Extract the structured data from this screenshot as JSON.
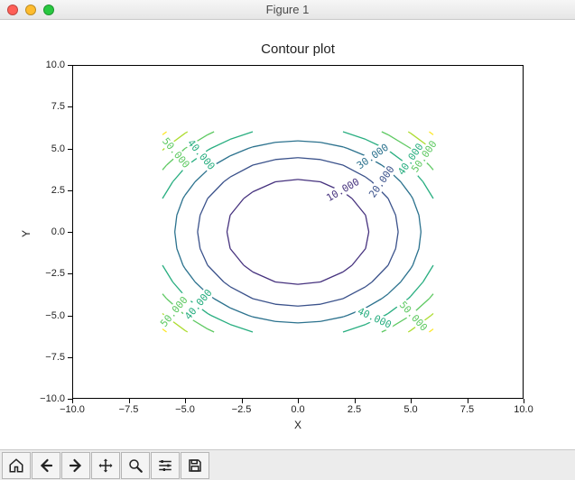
{
  "window": {
    "title": "Figure 1"
  },
  "chart_data": {
    "type": "contour",
    "title": "Contour plot",
    "xlabel": "X",
    "ylabel": "Y",
    "xlim": [
      -10.0,
      10.0
    ],
    "ylim": [
      -10.0,
      10.0
    ],
    "xticks": [
      -10.0,
      -7.5,
      -5.0,
      -2.5,
      0.0,
      2.5,
      5.0,
      7.5,
      10.0
    ],
    "yticks": [
      -10.0,
      -7.5,
      -5.0,
      -2.5,
      0.0,
      2.5,
      5.0,
      7.5,
      10.0
    ],
    "xtick_labels": [
      "−10.0",
      "−7.5",
      "−5.0",
      "−2.5",
      "0.0",
      "2.5",
      "5.0",
      "7.5",
      "10.0"
    ],
    "ytick_labels": [
      "−10.0",
      "−7.5",
      "−5.0",
      "−2.5",
      "0.0",
      "2.5",
      "5.0",
      "7.5",
      "10.0"
    ],
    "function": "z = x^2 + y^2",
    "levels": [
      10.0,
      20.0,
      30.0,
      40.0,
      50.0,
      60.0,
      70.0
    ],
    "level_colors": {
      "10": "#46327e",
      "20": "#3b528b",
      "30": "#2c728e",
      "40": "#28ae80",
      "50": "#5ec962",
      "60": "#addc30",
      "70": "#fde725"
    },
    "contour_labels": [
      {
        "level": 10.0,
        "text": "10.000",
        "x": 2.0,
        "y": 2.5,
        "angle": -30
      },
      {
        "level": 20.0,
        "text": "20.000",
        "x": 3.7,
        "y": 3.0,
        "angle": -55
      },
      {
        "level": 30.0,
        "text": "30.000",
        "x": 3.3,
        "y": 4.5,
        "angle": -35
      },
      {
        "level": 40.0,
        "text": "40.000",
        "x": -4.3,
        "y": 4.6,
        "angle": 50
      },
      {
        "level": 40.0,
        "text": "40.000",
        "x": 5.0,
        "y": 4.3,
        "angle": -55
      },
      {
        "level": 40.0,
        "text": "40.000",
        "x": -4.4,
        "y": -4.4,
        "angle": -50
      },
      {
        "level": 40.0,
        "text": "40.000",
        "x": 3.4,
        "y": -5.2,
        "angle": 25
      },
      {
        "level": 50.0,
        "text": "50.000",
        "x": -5.4,
        "y": 4.7,
        "angle": 50
      },
      {
        "level": 50.0,
        "text": "50.000",
        "x": 5.6,
        "y": 4.5,
        "angle": -55
      },
      {
        "level": 50.0,
        "text": "50.000",
        "x": -5.5,
        "y": -4.8,
        "angle": -50
      },
      {
        "level": 50.0,
        "text": "50.000",
        "x": 5.1,
        "y": -5.1,
        "angle": 48
      }
    ],
    "xgrid_data": [
      -6,
      -5,
      -4,
      -3,
      -2,
      -1,
      0,
      1,
      2,
      3,
      4,
      5,
      6
    ],
    "ygrid_data": [
      -6,
      -5,
      -4,
      -3,
      -2,
      -1,
      0,
      1,
      2,
      3,
      4,
      5,
      6
    ]
  },
  "toolbar": {
    "home": "Home",
    "back": "Back",
    "forward": "Forward",
    "pan": "Pan",
    "zoom": "Zoom",
    "config": "Configure subplots",
    "save": "Save"
  }
}
